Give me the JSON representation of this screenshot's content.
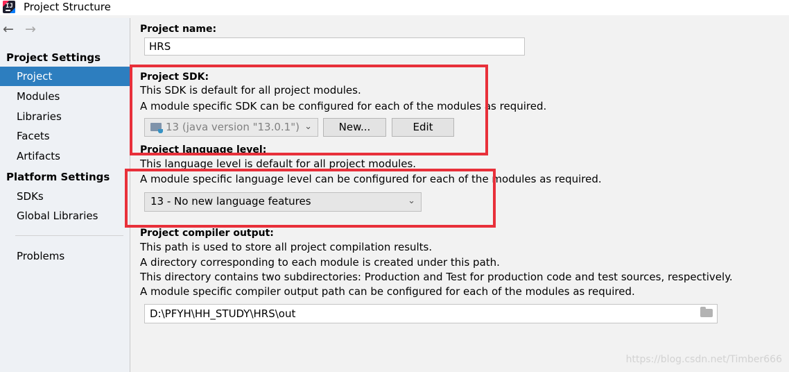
{
  "window": {
    "title": "Project Structure"
  },
  "sidebar": {
    "project_settings_header": "Project Settings",
    "project_items": [
      "Project",
      "Modules",
      "Libraries",
      "Facets",
      "Artifacts"
    ],
    "platform_settings_header": "Platform Settings",
    "platform_items": [
      "SDKs",
      "Global Libraries"
    ],
    "problems": "Problems",
    "selected": "Project"
  },
  "project_name": {
    "label": "Project name:",
    "value": "HRS"
  },
  "project_sdk": {
    "label": "Project SDK:",
    "desc1": "This SDK is default for all project modules.",
    "desc2": "A module specific SDK can be configured for each of the modules as required.",
    "selected": "13 (java version \"13.0.1\")",
    "new_button": "New...",
    "edit_button": "Edit"
  },
  "language_level": {
    "label": "Project language level:",
    "desc1": "This language level is default for all project modules.",
    "desc2": "A module specific language level can be configured for each of the modules as required.",
    "selected": "13 - No new language features"
  },
  "compiler_output": {
    "label": "Project compiler output:",
    "desc1": "This path is used to store all project compilation results.",
    "desc2": "A directory corresponding to each module is created under this path.",
    "desc3": "This directory contains two subdirectories: Production and Test for production code and test sources, respectively.",
    "desc4": "A module specific compiler output path can be configured for each of the modules as required.",
    "path": "D:\\PFYH\\HH_STUDY\\HRS\\out"
  },
  "watermark": "https://blog.csdn.net/Timber666",
  "colors": {
    "selection": "#2d7ebf",
    "highlight_box": "#e8303a"
  }
}
